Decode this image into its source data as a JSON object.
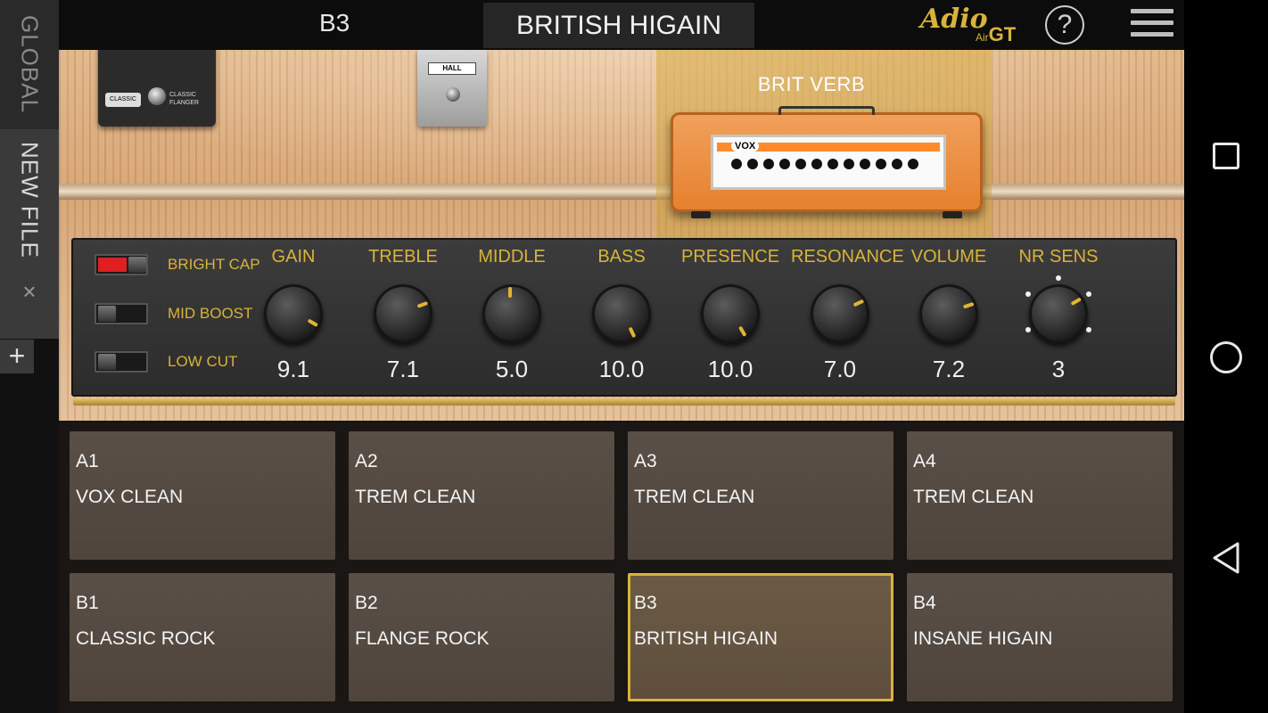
{
  "side_tabs": {
    "global_label": "GLOBAL",
    "newfile_label": "NEW FILE",
    "close_glyph": "×",
    "add_glyph": "+"
  },
  "topbar": {
    "slot": "B3",
    "preset_name": "BRITISH HIGAIN",
    "logo_script": "Adio",
    "logo_air": "Air",
    "logo_gt": "GT",
    "help_glyph": "?"
  },
  "stage": {
    "pedal_dark_switch": "CLASSIC",
    "pedal_dark_label": "CLASSIC FLANGER",
    "hall_label": "HALL",
    "amp_title": "BRIT VERB",
    "amp_brand": "VOX"
  },
  "switches": [
    {
      "label": "BRIGHT CAP",
      "on": true
    },
    {
      "label": "MID BOOST",
      "on": false
    },
    {
      "label": "LOW CUT",
      "on": false
    }
  ],
  "knobs": [
    {
      "label": "GAIN",
      "value": "9.1"
    },
    {
      "label": "TREBLE",
      "value": "7.1"
    },
    {
      "label": "MIDDLE",
      "value": "5.0"
    },
    {
      "label": "BASS",
      "value": "10.0"
    },
    {
      "label": "PRESENCE",
      "value": "10.0"
    },
    {
      "label": "RESONANCE",
      "value": "7.0"
    },
    {
      "label": "VOLUME",
      "value": "7.2"
    },
    {
      "label": "NR SENS",
      "value": "3"
    }
  ],
  "presets": [
    {
      "id": "A1",
      "name": "VOX CLEAN"
    },
    {
      "id": "A2",
      "name": "TREM CLEAN"
    },
    {
      "id": "A3",
      "name": "TREM CLEAN"
    },
    {
      "id": "A4",
      "name": "TREM CLEAN"
    },
    {
      "id": "B1",
      "name": "CLASSIC ROCK"
    },
    {
      "id": "B2",
      "name": "FLANGE ROCK"
    },
    {
      "id": "B3",
      "name": "BRITISH HIGAIN",
      "selected": true
    },
    {
      "id": "B4",
      "name": "INSANE HIGAIN"
    }
  ],
  "colors": {
    "accent_gold": "#d9b33a",
    "switch_on_red": "#e02020",
    "amp_orange": "#e5812e"
  }
}
